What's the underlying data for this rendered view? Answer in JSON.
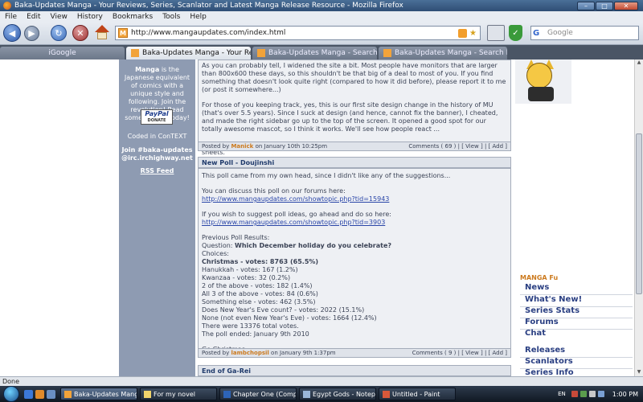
{
  "window": {
    "title": "Baka-Updates Manga - Your Reviews, Series, Scanlator and Latest Manga Release Resource - Mozilla Firefox"
  },
  "menu": [
    "File",
    "Edit",
    "View",
    "History",
    "Bookmarks",
    "Tools",
    "Help"
  ],
  "nav": {
    "url": "http://www.mangaupdates.com/index.html",
    "search_placeholder": "Google",
    "search_engine_glyph": "G"
  },
  "tabs": [
    {
      "label": "iGoogle",
      "active": false
    },
    {
      "label": "Baka-Updates Manga - Your Revie...",
      "active": true
    },
    {
      "label": "Baka-Updates Manga - Search Foru...",
      "active": false
    },
    {
      "label": "Baka-Updates Manga - Search Foru...",
      "active": false
    }
  ],
  "sidebar": {
    "site_name": "Manga",
    "blurb": "is the Japanese equivalent of comics with a unique style and following. Join the revolution! Read some manga today!",
    "paypal_label": "PayPal",
    "paypal_donate": "DONATE",
    "coded_in": "Coded in ConTEXT",
    "join_line1": "Join #baka-updates",
    "join_line2": "@irc.irchighway.net",
    "rss_link": "RSS Feed"
  },
  "post1": {
    "paragraphs": [
      "As you can probably tell, I widened the site a bit. Most people have monitors that are larger than 800x600 these days, so this shouldn't be that big of a deal to most of you. If you find something that doesn't look quite right (compared to how it did before), please report it to me (or post it somewhere...)",
      "For those of you keeping track, yes, this is our first site design change in the history of MU (that's over 5.5 years). Since I suck at design (and hence, cannot fix the banner), I cheated, and made the right sidebar go up to the top of the screen. It opened a good spot for our totally awesome mascot, so I think it works. We'll see how people react ...",
      "In case it doesn't quite look right, reload your page a few times. This should update your style sheets."
    ],
    "footer": {
      "posted_by": "Posted by",
      "author": "Manick",
      "date": "on January 10th 10:25pm",
      "comments_label": "Comments (",
      "comments_count": "69",
      "comments_close": ")",
      "view": "[ View ]",
      "add": "[ Add ]"
    }
  },
  "post2": {
    "title": "New Poll - Doujinshi",
    "intro": "This poll came from my own head, since I didn't like any of the suggestions...",
    "discuss_text": "You can discuss this poll on our forums here:",
    "discuss_link": "http://www.mangaupdates.com/showtopic.php?tid=15943",
    "suggest_text": "If you wish to suggest poll ideas, go ahead and do so here:",
    "suggest_link": "http://www.mangaupdates.com/showtopic.php?tid=3903",
    "results_heading": "Previous Poll Results:",
    "question_label": "Question:",
    "question": "Which December holiday do you celebrate?",
    "choices_label": "Choices:",
    "choices": [
      {
        "text": "Christmas - votes: 8763 (65.5%)",
        "bold": true
      },
      {
        "text": "Hanukkah - votes: 167 (1.2%)",
        "bold": false
      },
      {
        "text": "Kwanzaa - votes: 32 (0.2%)",
        "bold": false
      },
      {
        "text": "2 of the above - votes: 182 (1.4%)",
        "bold": false
      },
      {
        "text": "All 3 of the above - votes: 84 (0.6%)",
        "bold": false
      },
      {
        "text": "Something else - votes: 462 (3.5%)",
        "bold": false
      },
      {
        "text": "Does New Year's Eve count? - votes: 2022 (15.1%)",
        "bold": false
      },
      {
        "text": "None (not even New Year's Eve) - votes: 1664 (12.4%)",
        "bold": false
      }
    ],
    "total": "There were 13376 total votes.",
    "ended": "The poll ended: January 9th 2010",
    "signoff": "Go Christmas~",
    "footer": {
      "posted_by": "Posted by",
      "author": "lambchopsil",
      "date": "on January 9th 1:37pm",
      "comments_label": "Comments (",
      "comments_count": "9",
      "comments_close": ")",
      "view": "[ View ]",
      "add": "[ Add ]"
    }
  },
  "post3": {
    "title": "End of Ga-Rei"
  },
  "right_menu": {
    "title": "MANGA Fu",
    "items": [
      "News",
      "What's New!",
      "Series Stats",
      "Forums",
      "Chat",
      "Releases",
      "Scanlators",
      "Series Info"
    ]
  },
  "status": {
    "text": "Done"
  },
  "taskbar": {
    "tasks": [
      {
        "label": "Baka-Updates Mang...",
        "active": true,
        "color": "#f2a33a"
      },
      {
        "label": "For my novel",
        "active": false,
        "color": "#f0d36b"
      },
      {
        "label": "Chapter One (Comp...",
        "active": false,
        "color": "#2d64b8"
      },
      {
        "label": "Egypt Gods - Notep...",
        "active": false,
        "color": "#9ab6d8"
      },
      {
        "label": "Untitled - Paint",
        "active": false,
        "color": "#d8583a"
      }
    ],
    "lang": "EN",
    "clock": "1:00 PM"
  },
  "colors": {
    "sidebar": "#8e9bb2",
    "accent_orange": "#cc7a1e",
    "menu_blue": "#2a3f82"
  }
}
